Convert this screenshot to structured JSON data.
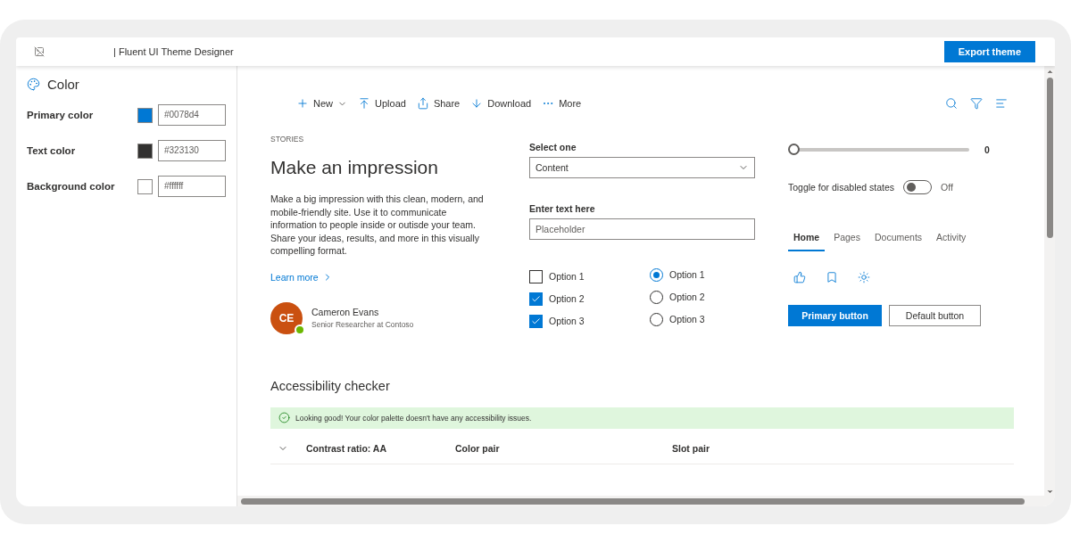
{
  "header": {
    "title": "| Fluent UI Theme Designer",
    "export_button": "Export theme"
  },
  "sidebar": {
    "heading": "Color",
    "colors": [
      {
        "label": "Primary color",
        "color": "#0078d4",
        "value": "#0078d4"
      },
      {
        "label": "Text color",
        "color": "#323130",
        "value": "#323130"
      },
      {
        "label": "Background color",
        "color": "#ffffff",
        "value": "#ffffff"
      }
    ]
  },
  "command_bar": {
    "items": [
      {
        "kind": "new",
        "label": "New",
        "has_menu": true
      },
      {
        "kind": "upload",
        "label": "Upload",
        "has_menu": false
      },
      {
        "kind": "share",
        "label": "Share",
        "has_menu": false
      },
      {
        "kind": "download",
        "label": "Download",
        "has_menu": false
      },
      {
        "kind": "more",
        "label": "More",
        "has_menu": false
      }
    ]
  },
  "story": {
    "eyebrow": "STORIES",
    "title": "Make an impression",
    "body": "Make a big impression with this clean, modern, and mobile-friendly site. Use it to communicate information to people inside or outisde your team. Share your ideas, results, and more in this visually compelling format.",
    "link": "Learn more",
    "persona": {
      "initials": "CE",
      "name": "Cameron Evans",
      "role": "Senior Researcher at Contoso",
      "online": true
    }
  },
  "form": {
    "dropdown": {
      "label": "Select one",
      "value": "Content"
    },
    "text_field": {
      "label": "Enter text here",
      "placeholder": "Placeholder"
    },
    "checkboxes": [
      {
        "label": "Option 1",
        "checked": false
      },
      {
        "label": "Option 2",
        "checked": true
      },
      {
        "label": "Option 3",
        "checked": true
      }
    ],
    "radios": [
      {
        "label": "Option 1",
        "selected": true
      },
      {
        "label": "Option 2",
        "selected": false
      },
      {
        "label": "Option 3",
        "selected": false
      }
    ]
  },
  "controls": {
    "slider": {
      "level": 0,
      "reading": "0"
    },
    "toggle": {
      "label": "Toggle for disabled states",
      "on": false,
      "state_text": "Off"
    },
    "tabs": [
      {
        "label": "Home",
        "selected": true
      },
      {
        "label": "Pages",
        "selected": false
      },
      {
        "label": "Documents",
        "selected": false
      },
      {
        "label": "Activity",
        "selected": false
      }
    ],
    "primary_button": "Primary button",
    "default_button": "Default button"
  },
  "accessibility": {
    "heading": "Accessibility checker",
    "message": "Looking good! Your color palette doesn't have any accessibility issues.",
    "columns": [
      "Contrast ratio: AA",
      "Color pair",
      "Slot pair"
    ]
  }
}
